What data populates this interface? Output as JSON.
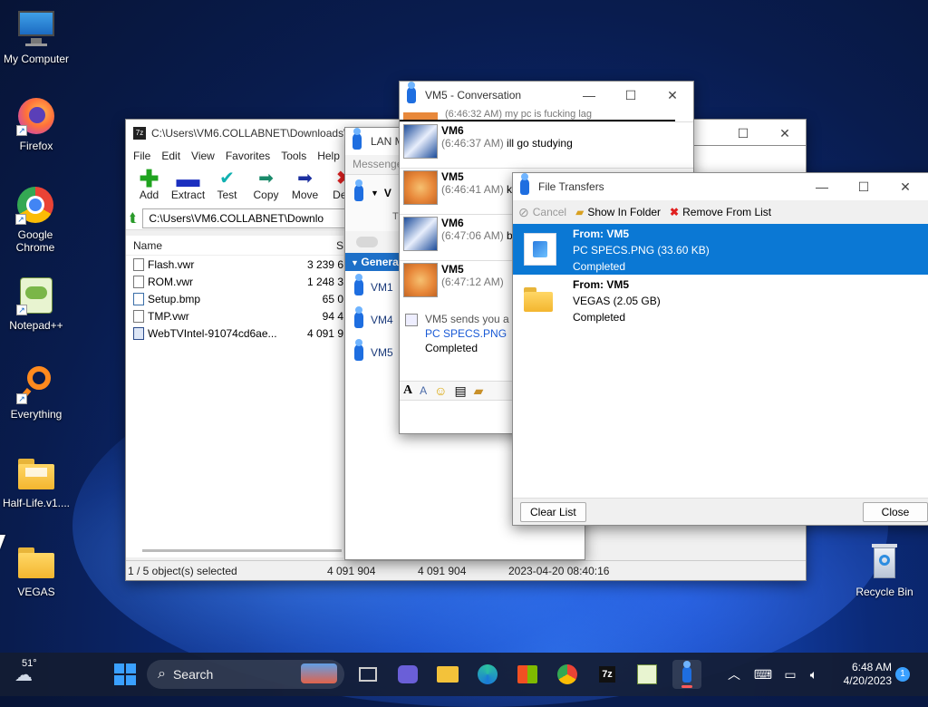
{
  "desktop": {
    "icons": [
      {
        "label": "My Computer"
      },
      {
        "label": "Firefox"
      },
      {
        "label": "Google Chrome"
      },
      {
        "label": "Notepad++"
      },
      {
        "label": "Everything"
      },
      {
        "label": "Half-Life.v1...."
      },
      {
        "label": "VEGAS"
      },
      {
        "label": "Recycle Bin"
      }
    ]
  },
  "sevenzip": {
    "title": "C:\\Users\\VM6.COLLABNET\\Downloads\\W...",
    "menu": [
      "File",
      "Edit",
      "View",
      "Favorites",
      "Tools",
      "Help"
    ],
    "tools": [
      "Add",
      "Extract",
      "Test",
      "Copy",
      "Move",
      "Dele"
    ],
    "address": "C:\\Users\\VM6.COLLABNET\\Downlo",
    "columns": {
      "name": "Name",
      "size": "S"
    },
    "files": [
      {
        "name": "Flash.vwr",
        "size": "3 239 6"
      },
      {
        "name": "ROM.vwr",
        "size": "1 248 3"
      },
      {
        "name": "Setup.bmp",
        "size": "65 0"
      },
      {
        "name": "TMP.vwr",
        "size": "94 4"
      },
      {
        "name": "WebTVIntel-91074cd6ae...",
        "size": "4 091 9"
      }
    ],
    "status": {
      "selected": "1 / 5 object(s) selected",
      "size1": "4 091 904",
      "size2": "4 091 904",
      "date": "2023-04-20 08:40:16"
    }
  },
  "lan": {
    "title": "LAN M",
    "search_placeholder": "Messenge",
    "group": "General",
    "users": [
      "VM1",
      "VM4",
      "VM5"
    ],
    "tab_letter": "T",
    "self_letter": "V"
  },
  "conversation": {
    "title": "VM5 - Conversation",
    "top_line": "(6:46:32 AM) my pc is fucking lag",
    "messages": [
      {
        "who": "VM6",
        "time": "(6:46:37 AM)",
        "text": "ill go studying"
      },
      {
        "who": "VM5",
        "time": "(6:46:41 AM)",
        "text": "k"
      },
      {
        "who": "VM6",
        "time": "(6:47:06 AM)",
        "text": "b"
      },
      {
        "who": "VM5",
        "time": "(6:47:12 AM)",
        "text": ""
      }
    ],
    "notice": {
      "line1": "VM5 sends you a",
      "file": "PC SPECS.PNG",
      "status": "Completed"
    }
  },
  "file_transfers": {
    "title": "File Transfers",
    "toolbar": {
      "cancel": "Cancel",
      "show_in_folder": "Show In Folder",
      "remove": "Remove From List"
    },
    "items": [
      {
        "from": "From: VM5",
        "file": "PC SPECS.PNG (33.60 KB)",
        "status": "Completed",
        "selected": true
      },
      {
        "from": "From: VM5",
        "file": "VEGAS (2.05 GB)",
        "status": "Completed",
        "selected": false
      }
    ],
    "clear_label": "Clear List",
    "close_label": "Close"
  },
  "taskbar": {
    "weather": "51°",
    "search": "Search",
    "time": "6:48 AM",
    "date": "4/20/2023",
    "notifications": "1"
  },
  "colors": {
    "accent": "#0b78d4",
    "group": "#1e70c8",
    "taskbar": "#141c32"
  }
}
